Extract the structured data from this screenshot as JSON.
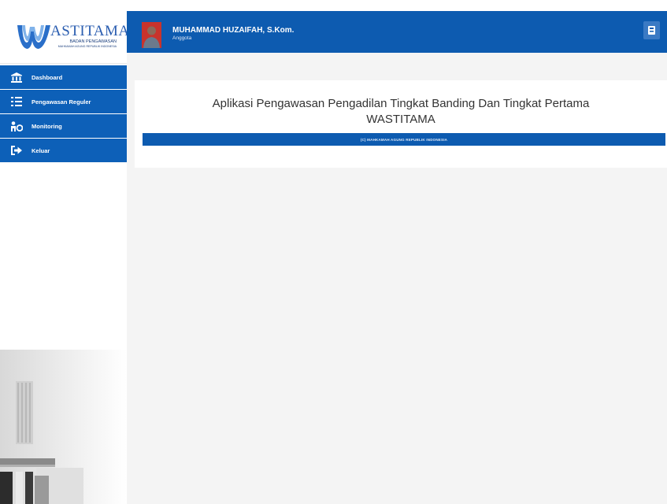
{
  "app": {
    "logo_title": "ASTITAMA",
    "logo_subtitle": "BADAN PENGAWASAN",
    "logo_subtitle2": "MAHKAMAH AGUNG REPUBLIK INDONESIA"
  },
  "header": {
    "user_name": "MUHAMMAD HUZAIFAH, S.Kom.",
    "user_role": "Anggota",
    "action_icon": "contact-card-icon"
  },
  "sidebar": {
    "items": [
      {
        "label": "Dashboard",
        "icon": "bank-icon"
      },
      {
        "label": "Pengawasan Reguler",
        "icon": "list-icon"
      },
      {
        "label": "Monitoring",
        "icon": "user-monitor-icon"
      },
      {
        "label": "Keluar",
        "icon": "sign-out-icon"
      }
    ]
  },
  "main": {
    "title": "Aplikasi Pengawasan Pengadilan Tingkat Banding Dan Tingkat Pertama",
    "subtitle": "WASTITAMA",
    "copyright": "(C) MAHKAMAH AGUNG REPUBLIK INDONESIA"
  },
  "colors": {
    "primary": "#0d5bb0",
    "menu_bg": "#0d60b8",
    "content_bg": "#f4f4f4"
  }
}
